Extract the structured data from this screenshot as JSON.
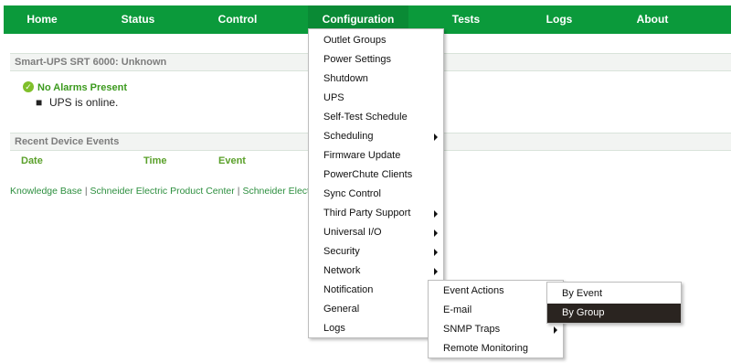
{
  "nav": {
    "items": [
      {
        "label": "Home"
      },
      {
        "label": "Status"
      },
      {
        "label": "Control"
      },
      {
        "label": "Configuration"
      },
      {
        "label": "Tests"
      },
      {
        "label": "Logs"
      },
      {
        "label": "About"
      }
    ]
  },
  "status_panel": {
    "title": "Smart-UPS SRT 6000: Unknown",
    "alarm_icon": "check-circle-icon",
    "alarm_text": "No Alarms Present",
    "status_text": "UPS is online."
  },
  "events_panel": {
    "title": "Recent Device Events",
    "columns": [
      "Date",
      "Time",
      "Event"
    ]
  },
  "footer": {
    "links": [
      "Knowledge Base",
      "Schneider Electric Product Center",
      "Schneider Electr"
    ]
  },
  "configuration_menu": {
    "items": [
      {
        "label": "Outlet Groups",
        "submenu": false
      },
      {
        "label": "Power Settings",
        "submenu": false
      },
      {
        "label": "Shutdown",
        "submenu": false
      },
      {
        "label": "UPS",
        "submenu": false
      },
      {
        "label": "Self-Test Schedule",
        "submenu": false
      },
      {
        "label": "Scheduling",
        "submenu": true
      },
      {
        "label": "Firmware Update",
        "submenu": false
      },
      {
        "label": "PowerChute Clients",
        "submenu": false
      },
      {
        "label": "Sync Control",
        "submenu": false
      },
      {
        "label": "Third Party Support",
        "submenu": true
      },
      {
        "label": "Universal I/O",
        "submenu": true
      },
      {
        "label": "Security",
        "submenu": true
      },
      {
        "label": "Network",
        "submenu": true
      },
      {
        "label": "Notification",
        "submenu": true
      },
      {
        "label": "General",
        "submenu": false
      },
      {
        "label": "Logs",
        "submenu": false
      }
    ]
  },
  "notification_menu": {
    "items": [
      {
        "label": "Event Actions",
        "submenu": true
      },
      {
        "label": "E-mail",
        "submenu": false
      },
      {
        "label": "SNMP Traps",
        "submenu": true
      },
      {
        "label": "Remote Monitoring",
        "submenu": false
      }
    ]
  },
  "event_actions_menu": {
    "items": [
      {
        "label": "By Event",
        "selected": false
      },
      {
        "label": "By Group",
        "selected": true
      }
    ]
  },
  "colors": {
    "nav_green": "#0b9a3b",
    "alarm_green": "#3c9a1e",
    "link_green": "#2d8f3f",
    "selected_bg": "#2a2420"
  }
}
